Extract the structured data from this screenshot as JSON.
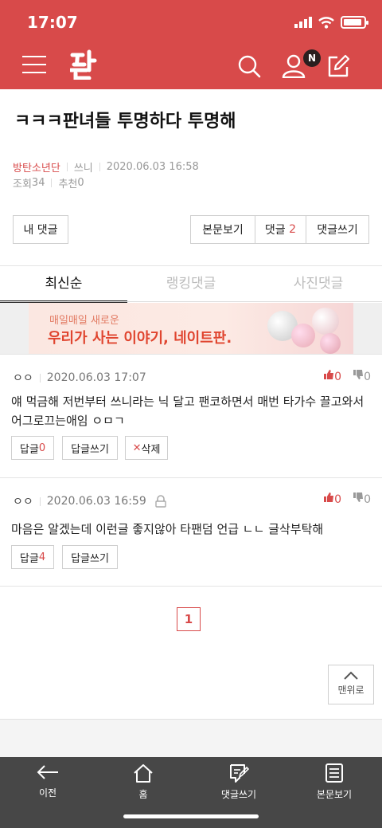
{
  "status": {
    "time": "17:07"
  },
  "header": {
    "badge": "N"
  },
  "post": {
    "title": "ㅋㅋㅋ판녀들 투명하다 투명해",
    "category": "방탄소년단",
    "author": "쓰니",
    "datetime": "2020.06.03 16:58",
    "views_label": "조회",
    "views": "34",
    "recommend_label": "추천",
    "recommend": "0"
  },
  "actions": {
    "my_comments": "내 댓글",
    "view_post": "본문보기",
    "comments_label": "댓글",
    "comments_count": "2",
    "write_comment": "댓글쓰기"
  },
  "tabs": [
    "최신순",
    "랭킹댓글",
    "사진댓글"
  ],
  "banner": {
    "sub": "매일매일 새로운",
    "main": "우리가 사는 이야기, 네이트판."
  },
  "comments": [
    {
      "nick": "ㅇㅇ",
      "datetime": "2020.06.03 17:07",
      "up": "0",
      "down": "0",
      "body": "얘 먹금해 저번부터 쓰니라는 닉 달고 팬코하면서 매번 타가수 끌고와서 어그로끄는애임 ㅇㅁㄱ",
      "reply_label": "답글",
      "reply_count": "0",
      "write_reply": "답글쓰기",
      "delete": "삭제"
    },
    {
      "nick": "ㅇㅇ",
      "datetime": "2020.06.03 16:59",
      "up": "0",
      "down": "0",
      "body": "마음은 알겠는데 이런글 좋지않아 타팬덤 언급 ㄴㄴ 글삭부탁해",
      "reply_label": "답글",
      "reply_count": "4",
      "write_reply": "답글쓰기"
    }
  ],
  "pagination": {
    "current": "1"
  },
  "to_top": "맨위로",
  "bottom_nav": {
    "prev": "이전",
    "home": "홈",
    "write_comment": "댓글쓰기",
    "view_post": "본문보기"
  },
  "colors": {
    "brand": "#d84a4a",
    "bottom_bar": "#474747"
  }
}
